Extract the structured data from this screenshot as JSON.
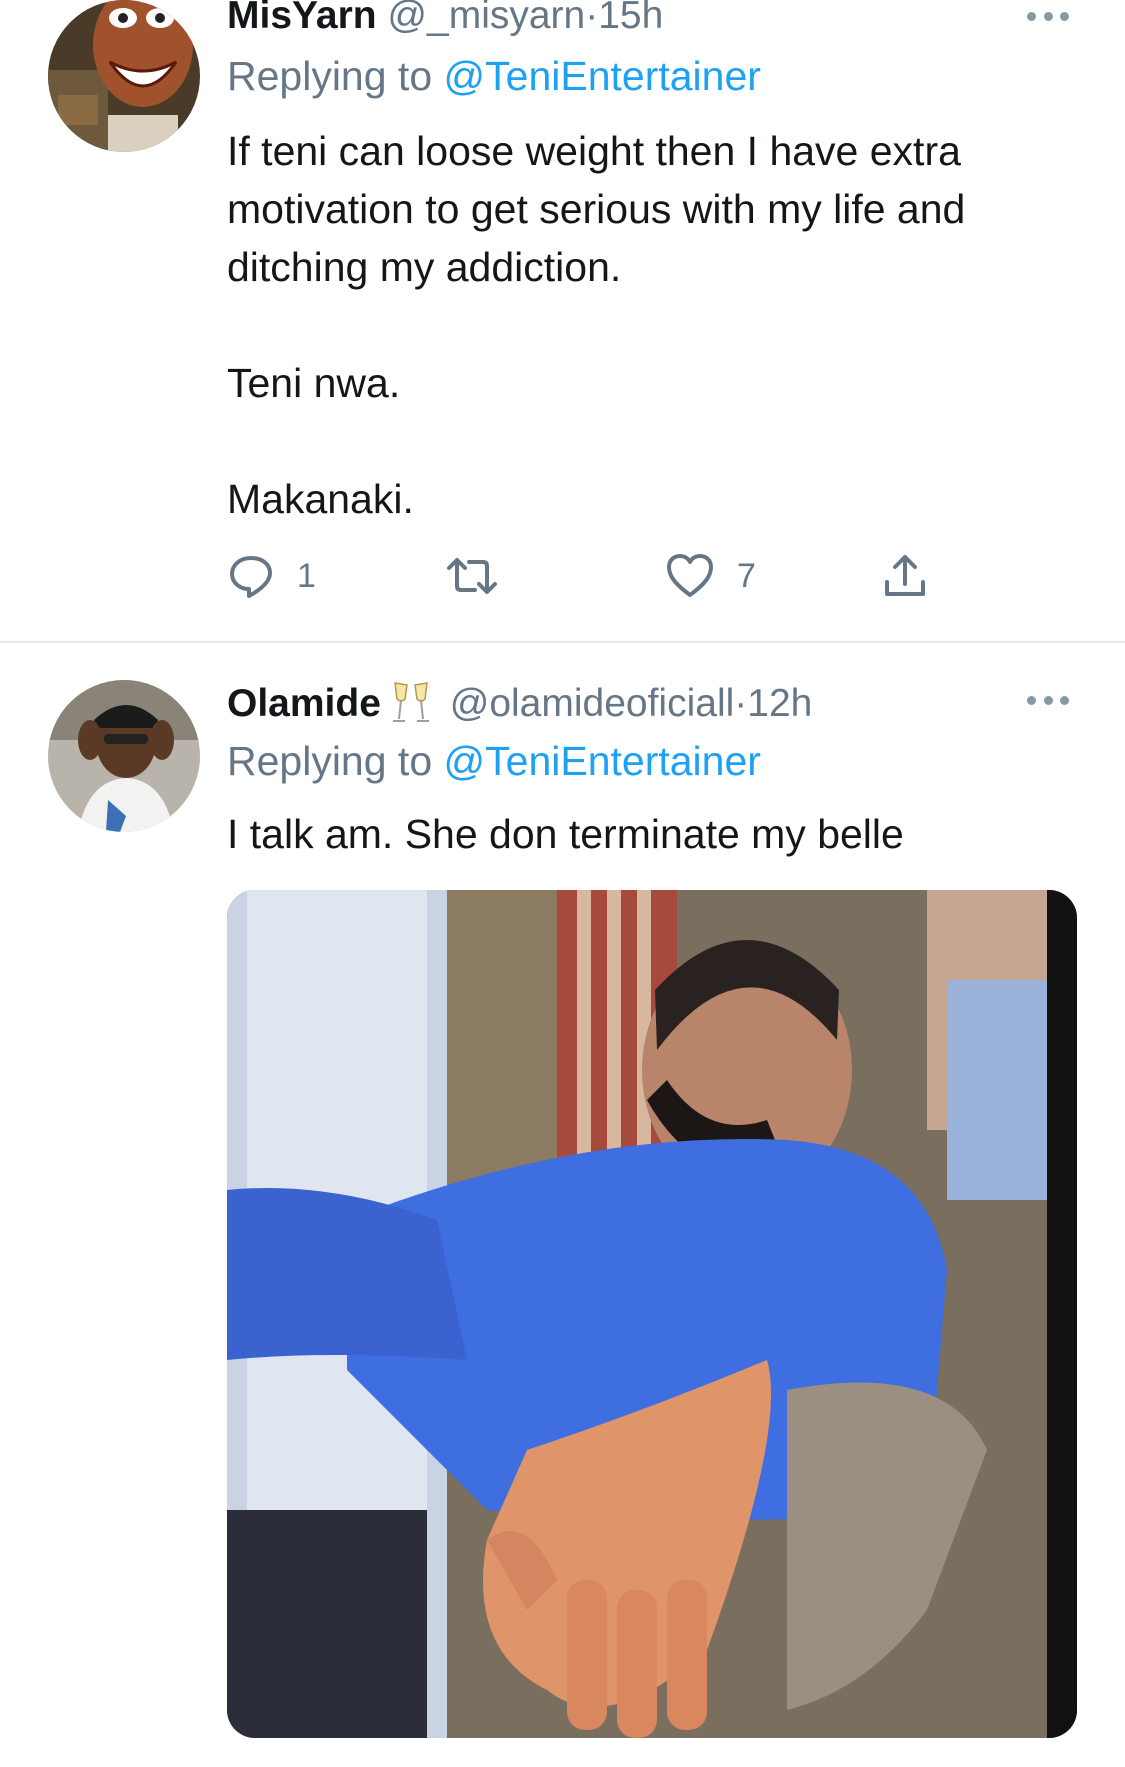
{
  "tweets": [
    {
      "display_name": "MisYarn",
      "handle": "@_misyarn",
      "separator": "·",
      "time": "15h",
      "replying_prefix": "Replying to",
      "replying_to": "@TeniEntertainer",
      "body": "If teni can loose weight then I have extra motivation to get serious with my life and ditching my addiction.\n\nTeni nwa.\n\nMakanaki.",
      "actions": {
        "reply_count": "1",
        "retweet_count": "",
        "like_count": "7"
      },
      "icons": [
        "reply-icon",
        "retweet-icon",
        "heart-icon",
        "share-icon",
        "more-icon"
      ]
    },
    {
      "display_name": "Olamide",
      "emoji": "champagne-glasses",
      "handle": "@olamideoficiall",
      "separator": "·",
      "time": "12h",
      "replying_prefix": "Replying to",
      "replying_to": "@TeniEntertainer",
      "body": "I talk am. She don terminate my belle",
      "media": "gif"
    }
  ],
  "colors": {
    "text": "#14171a",
    "secondary": "#657786",
    "link": "#1da1f2",
    "divider": "#e1e8ed"
  }
}
